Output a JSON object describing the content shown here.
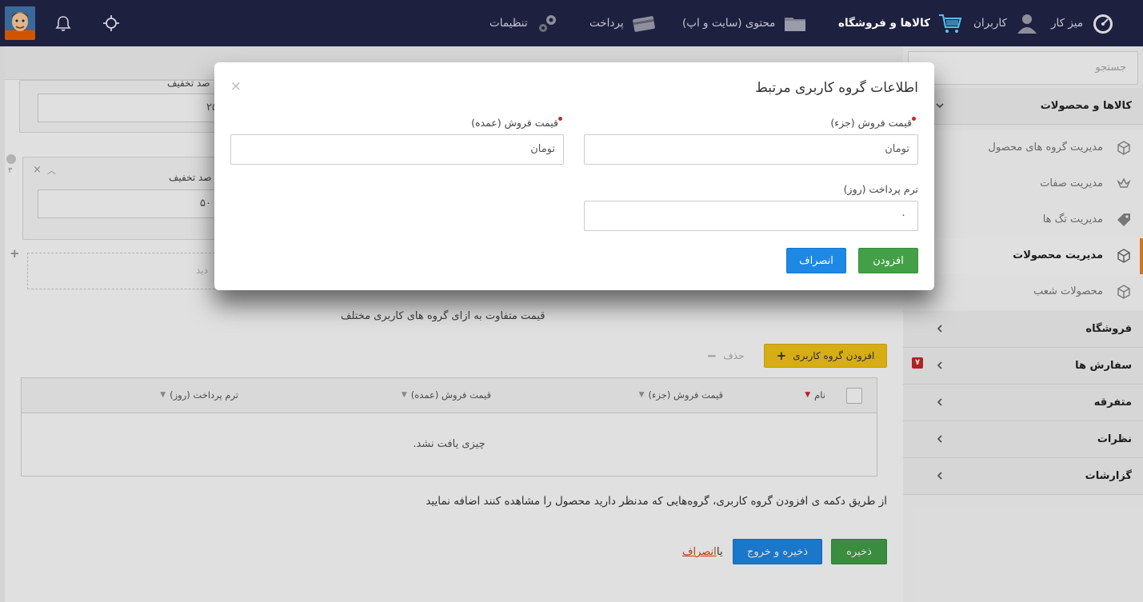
{
  "topbar": {
    "nav": [
      {
        "key": "dashboard",
        "label": "میز کار",
        "icon": "gauge-icon"
      },
      {
        "key": "users",
        "label": "کاربران",
        "icon": "user-icon"
      },
      {
        "key": "shop",
        "label": "کالاها و فروشگاه",
        "icon": "cart-icon",
        "active": true
      },
      {
        "key": "content",
        "label": "محتوی (سایت و اپ)",
        "icon": "folder-icon"
      },
      {
        "key": "payment",
        "label": "پرداخت",
        "icon": "card-icon"
      },
      {
        "key": "settings",
        "label": "تنظیمات",
        "icon": "gears-icon"
      }
    ],
    "utility_icons": [
      "crosshair-icon",
      "bell-icon",
      "avatar"
    ]
  },
  "sidebar": {
    "search_placeholder": "جستجو",
    "sections": [
      {
        "label": "کالاها و محصولات",
        "expanded": true
      },
      {
        "label": "فروشگاه"
      },
      {
        "label": "سفارش ها",
        "badge": "۷"
      },
      {
        "label": "متفرقه"
      },
      {
        "label": "نظرات"
      },
      {
        "label": "گزارشات"
      }
    ],
    "subitems": [
      {
        "label": "مدیریت گروه های محصول",
        "icon": "box-icon"
      },
      {
        "label": "مدیریت صفات",
        "icon": "crown-icon"
      },
      {
        "label": "مدیریت تگ ها",
        "icon": "tag-icon"
      },
      {
        "label": "مدیریت محصولات",
        "icon": "box-icon",
        "active": true
      },
      {
        "label": "محصولات شعب",
        "icon": "box-icon"
      }
    ]
  },
  "content": {
    "panel1_label": "صد تخفیف",
    "panel1_value": "۲۵",
    "panel2_label": "صد تخفیف",
    "panel2_value": "۵۰",
    "panel2_index": "۳",
    "dashed_placeholder": "دید",
    "section_caption": "قیمت متفاوت به ازای گروه های کاربری مختلف",
    "add_group_button": "افزودن گروه کاربری",
    "delete_button": "حذف",
    "grid": {
      "columns": [
        "نام",
        "قیمت فروش (جزء)",
        "قیمت فروش (عمده)",
        "ترم پرداخت (روز)"
      ],
      "empty_text": "چیزی یافت نشد."
    },
    "hint": "از طریق دکمه ی افزودن گروه کاربری، گروه‌هایی که مدنظر دارید محصول را مشاهده کنند اضافه نمایید",
    "save_button": "ذخیره",
    "save_exit_button": "ذخیره و خروج",
    "or_text": "یا",
    "cancel_link": "انصراف"
  },
  "modal": {
    "title": "اطلاعات گروه کاربری مرتبط",
    "close": "×",
    "retail_label": "قیمت فروش (جزء)",
    "retail_value": "تومان",
    "wholesale_label": "قیمت فروش (عمده)",
    "wholesale_value": "تومان",
    "term_label": "ترم پرداخت (روز)",
    "term_value": "۰",
    "add_button": "افزودن",
    "cancel_button": "انصراف"
  },
  "colors": {
    "topbar": "#1e2040",
    "accent_orange": "#e8872c",
    "green": "#43a047",
    "blue": "#1e88e5",
    "yellow": "#f5c518",
    "required": "#c62828"
  }
}
